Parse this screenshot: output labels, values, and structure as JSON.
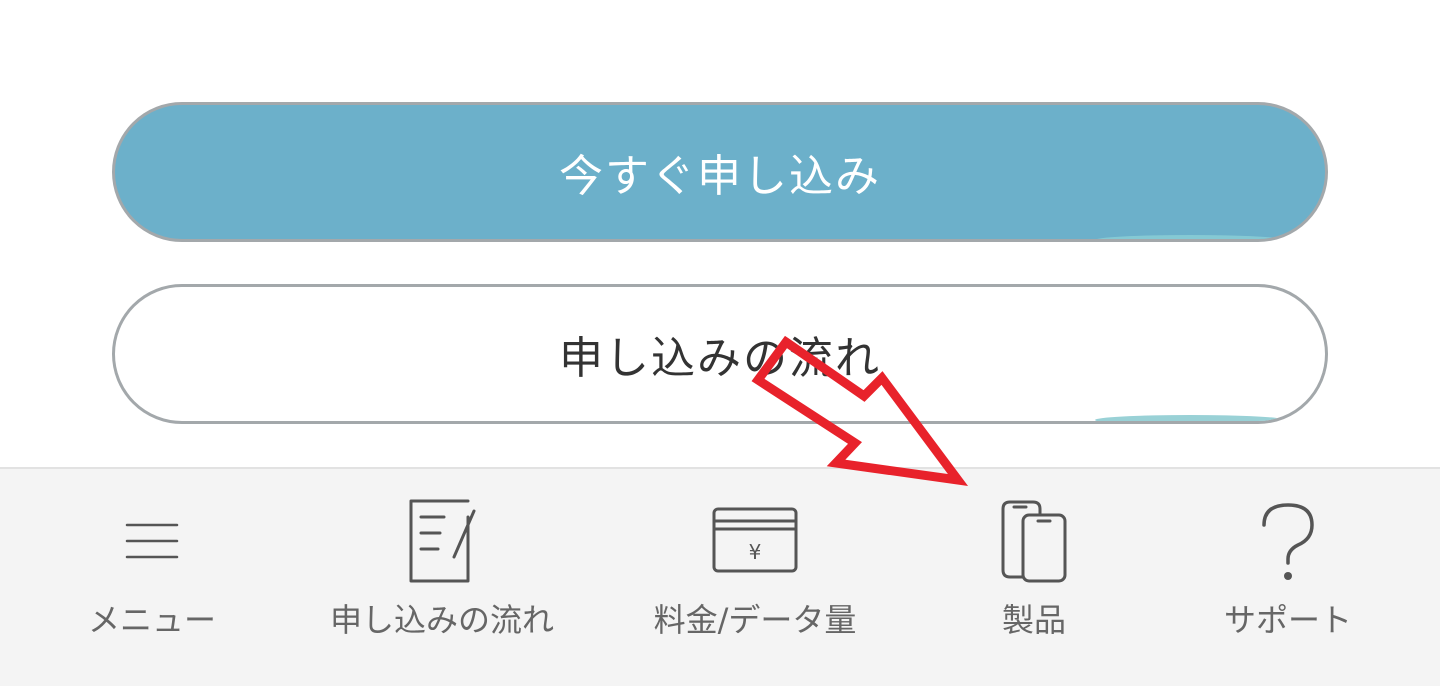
{
  "buttons": {
    "apply_now": "今すぐ申し込み",
    "application_flow": "申し込みの流れ"
  },
  "bottom_nav": {
    "items": [
      {
        "label": "メニュー",
        "icon": "hamburger-menu-icon"
      },
      {
        "label": "申し込みの流れ",
        "icon": "document-edit-icon"
      },
      {
        "label": "料金/データ量",
        "icon": "yen-card-icon"
      },
      {
        "label": "製品",
        "icon": "smartphones-icon"
      },
      {
        "label": "サポート",
        "icon": "question-mark-icon"
      }
    ]
  },
  "colors": {
    "primary_button": "#6cb0ca",
    "button_border": "#a3a8ab",
    "nav_background": "#f4f4f4",
    "nav_text": "#666666",
    "annotation_arrow": "#e8222b"
  }
}
